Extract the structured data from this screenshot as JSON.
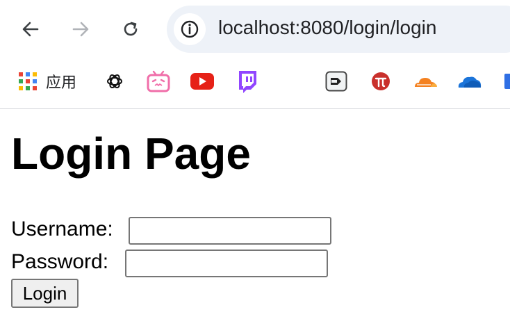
{
  "browser": {
    "url": "localhost:8080/login/login",
    "bookmarks": {
      "apps_label": "应用",
      "items": [
        "chatgpt-icon",
        "bilibili-icon",
        "youtube-icon",
        "twitch-icon",
        "arrow-box-icon",
        "pi-icon",
        "cloudflare-icon",
        "onedrive-icon"
      ]
    }
  },
  "page": {
    "title": "Login Page",
    "username_label": "Username:",
    "password_label": "Password:",
    "username_value": "",
    "password_value": "",
    "login_button": "Login"
  },
  "colors": {
    "omnibox_bg": "#eef2f8",
    "youtube_red": "#e62117",
    "twitch_purple": "#9146ff",
    "bilibili_pink": "#f06ea9",
    "cloudflare_orange": "#f48120",
    "onedrive_blue": "#1b74d9",
    "pi_red": "#c9302c"
  }
}
